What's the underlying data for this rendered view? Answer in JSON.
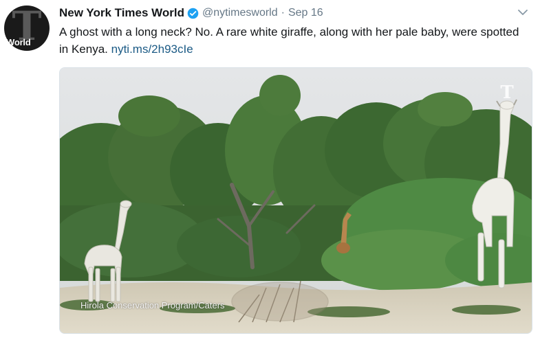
{
  "tweet": {
    "display_name": "New York Times World",
    "handle": "@nytimesworld",
    "separator": "·",
    "timestamp": "Sep 16",
    "text_before_link": "A ghost with a long neck? No. A rare white giraffe, along with her pale baby, were spotted in Kenya. ",
    "link_text": "nyti.ms/2h93cIe",
    "verified": true
  },
  "avatar": {
    "label": "World",
    "logo_glyph": "T"
  },
  "media": {
    "credit": "Hirola Conservation Program/Caters",
    "watermark_glyph": "T"
  },
  "icons": {
    "verified": "verified-badge-icon",
    "caret": "chevron-down-icon"
  },
  "colors": {
    "link": "#1b5a85",
    "verified": "#1da1f2",
    "name": "#14171a",
    "meta": "#657786"
  }
}
